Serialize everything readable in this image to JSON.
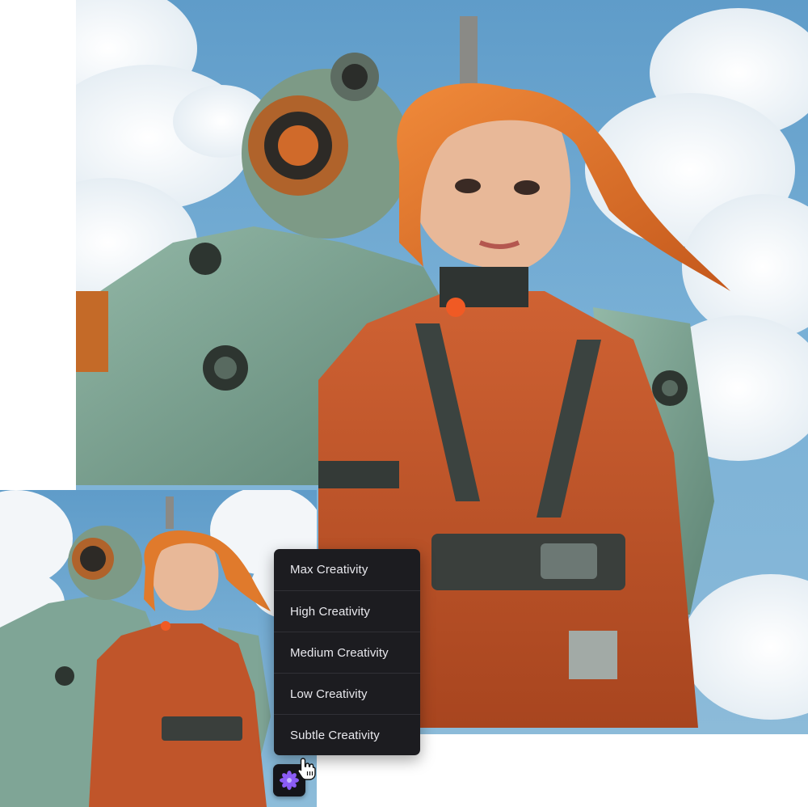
{
  "creativity_menu": {
    "options": [
      {
        "label": "Max Creativity"
      },
      {
        "label": "High Creativity"
      },
      {
        "label": "Medium Creativity"
      },
      {
        "label": "Low Creativity"
      },
      {
        "label": "Subtle Creativity"
      }
    ]
  },
  "creativity_button": {
    "icon": "sparkle-flower-icon",
    "accent_color": "#8b5cf6"
  },
  "cursor": {
    "icon": "hand-pointer-icon"
  },
  "colors": {
    "menu_background": "#1c1c20",
    "menu_text": "#e9e9ee",
    "sky": "#6fa8d1",
    "suit_orange": "#c0552a",
    "robot_green": "#7fa596",
    "hair": "#e07a2c"
  }
}
